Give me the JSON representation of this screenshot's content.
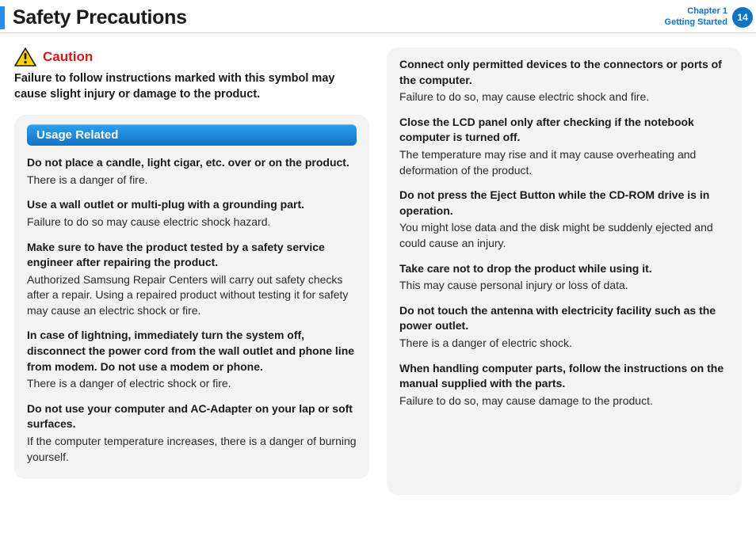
{
  "header": {
    "title": "Safety Precautions",
    "chapter_line1": "Chapter 1",
    "chapter_line2": "Getting Started",
    "page_number": "14"
  },
  "caution": {
    "label": "Caution",
    "text": "Failure to follow instructions marked with this symbol may cause slight injury or damage to the product."
  },
  "section": {
    "title": "Usage Related"
  },
  "left_items": [
    {
      "h": "Do not place a candle, light cigar, etc. over or on the product.",
      "b": "There is a danger of fire."
    },
    {
      "h": "Use a wall outlet or multi-plug with a grounding part.",
      "b": "Failure to do so may cause electric shock hazard."
    },
    {
      "h": "Make sure to have the product tested by a safety service engineer after repairing the product.",
      "b": "Authorized Samsung Repair Centers will carry out safety checks after a repair. Using a repaired product without testing it for safety may cause an electric shock or fire."
    },
    {
      "h": "In case of lightning, immediately turn the system off, disconnect the power cord from the wall outlet and phone line from modem. Do not use a modem or phone.",
      "b": "There is a danger of electric shock or fire."
    },
    {
      "h": "Do not use your computer and AC-Adapter on your lap or soft surfaces.",
      "b": "If the computer temperature increases, there is a danger of burning yourself."
    }
  ],
  "right_items": [
    {
      "h": "Connect only permitted devices to the connectors or ports of the computer.",
      "b": "Failure to do so, may cause electric shock and fire."
    },
    {
      "h": "Close the LCD panel only after checking if the notebook computer is turned off.",
      "b": "The temperature may rise and it may cause overheating and deformation of the product."
    },
    {
      "h": "Do not press the Eject Button while the CD-ROM drive is in operation.",
      "b": "You might lose data and the disk might be suddenly ejected and could cause an injury."
    },
    {
      "h": "Take care not to drop the product while using it.",
      "b": "This may cause personal injury or loss of data."
    },
    {
      "h": "Do not touch the antenna with electricity facility such as the power outlet.",
      "b": "There is a danger of electric shock."
    },
    {
      "h": "When handling computer parts, follow the instructions on the manual supplied with the parts.",
      "b": "Failure to do so, may cause damage to the product."
    }
  ]
}
